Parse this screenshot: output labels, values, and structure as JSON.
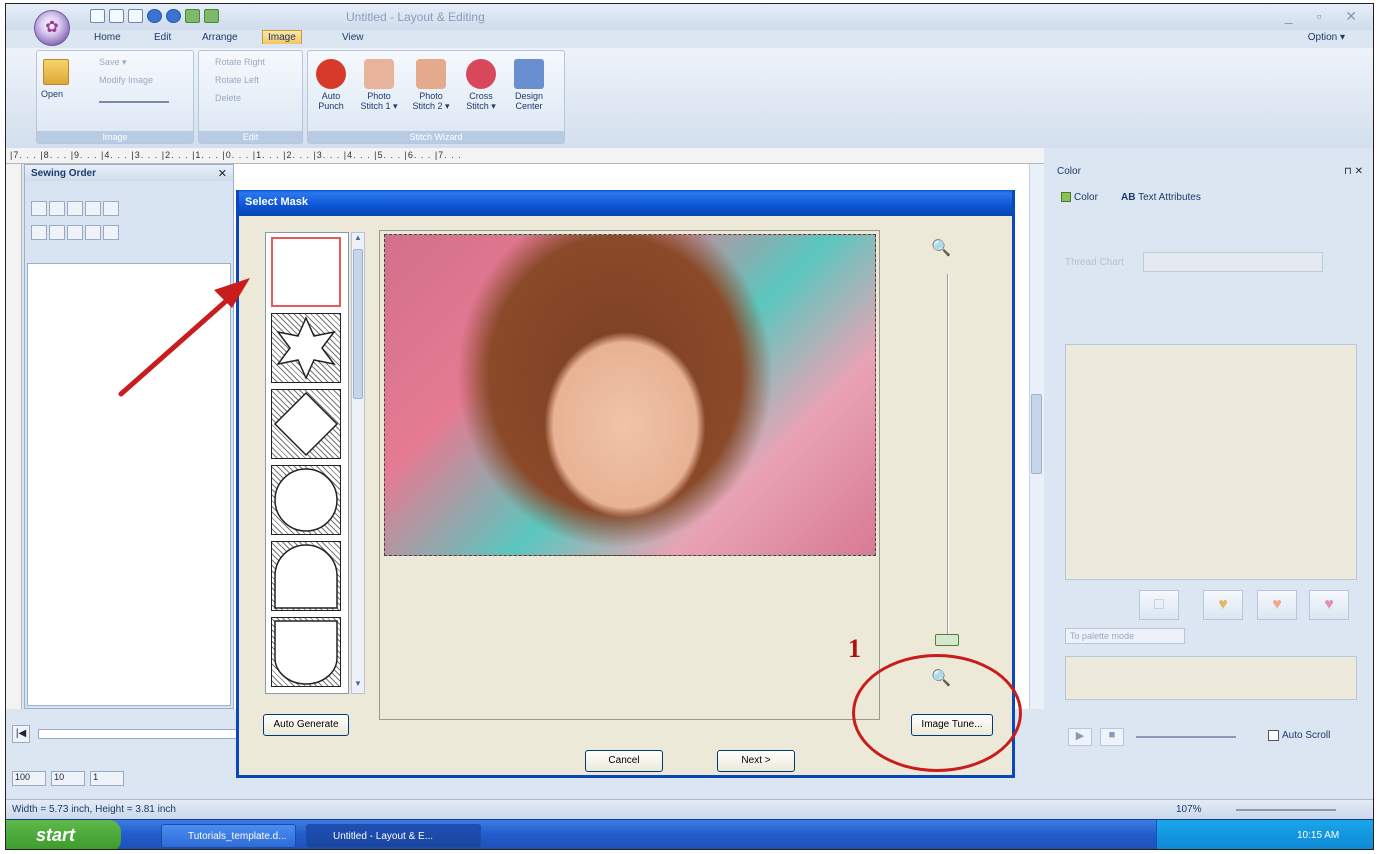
{
  "window": {
    "title": "Untitled - Layout & Editing",
    "controls": "_ ▫ ✕"
  },
  "tabs": [
    "Home",
    "Edit",
    "Arrange",
    "Image",
    "View"
  ],
  "option_label": "Option ▾",
  "ribbon": {
    "image_group": {
      "open": "Open",
      "save": "Save ▾",
      "modify": "Modify Image",
      "label": "Image"
    },
    "edit_group": {
      "rotate_right": "Rotate Right",
      "rotate_left": "Rotate Left",
      "delete": "Delete",
      "label": "Edit"
    },
    "stitch_group": {
      "label": "Stitch Wizard",
      "buttons": [
        {
          "l1": "Auto",
          "l2": "Punch",
          "color": "#d83a2a"
        },
        {
          "l1": "Photo",
          "l2": "Stitch 1 ▾",
          "color": "#e7b39a"
        },
        {
          "l1": "Photo",
          "l2": "Stitch 2 ▾",
          "color": "#e5a98e"
        },
        {
          "l1": "Cross",
          "l2": "Stitch ▾",
          "color": "#d8485a"
        },
        {
          "l1": "Design",
          "l2": "Center",
          "color": "#6a8fd0"
        }
      ]
    }
  },
  "ruler_text": "|7.  .  .  |8.  .  .  |9.  .  .  |4.  .  .  |3.  .  .  |2.  .  .  |1.  .  .  |0.  .  .  |1.  .  .  |2.  .  .  |3.  .  .  |4.  .  .  |5.  .  .  |6.  .  .  |7.  .  .",
  "sewing_order": {
    "title": "Sewing Order",
    "close": "✕"
  },
  "color_panel": {
    "title": "Color",
    "pin": "⊓ ✕",
    "tab_color": "Color",
    "tab_text": "Text Attributes",
    "thread_chart_label": "Thread Chart",
    "palette_mode": "To palette mode",
    "auto_scroll": "Auto Scroll"
  },
  "dialog": {
    "title": "Select Mask",
    "auto_generate": "Auto Generate",
    "image_tune": "Image Tune...",
    "cancel": "Cancel",
    "next": "Next >"
  },
  "annotation": {
    "number": "1",
    "arrow_color": "#c91c1c"
  },
  "status": {
    "text": "Width = 5.73 inch, Height = 3.81 inch",
    "zoom": "107%"
  },
  "taskbar": {
    "start": "start",
    "tasks": [
      "Tutorials_template.d...",
      "Untitled - Layout & E..."
    ],
    "clock": "10:15 AM"
  },
  "bottom": {
    "stitch_counts": [
      "100",
      "10",
      "1"
    ]
  }
}
